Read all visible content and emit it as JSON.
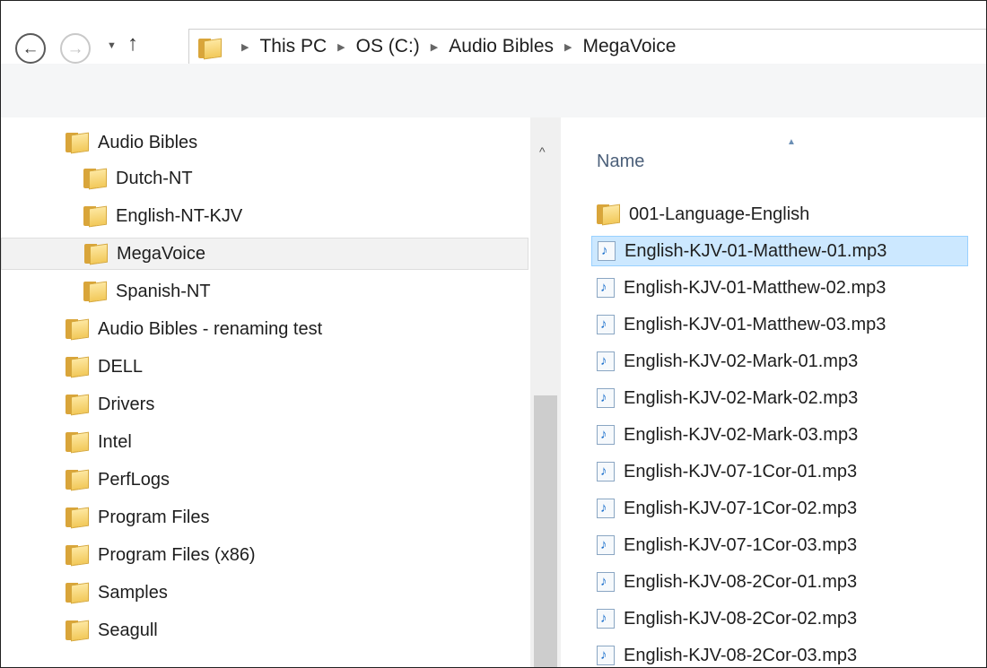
{
  "breadcrumb": [
    "This PC",
    "OS (C:)",
    "Audio Bibles",
    "MegaVoice"
  ],
  "colors": {
    "selection": "#cce8ff",
    "folder": "#f2c95a",
    "header_text": "#4c607a"
  },
  "nav_tree": [
    {
      "label": "Audio Bibles",
      "icon": "folder-icon",
      "selected": false
    },
    {
      "label": "Dutch-NT",
      "icon": "folder-icon",
      "selected": false
    },
    {
      "label": "English-NT-KJV",
      "icon": "folder-icon",
      "selected": false
    },
    {
      "label": "MegaVoice",
      "icon": "folder-icon",
      "selected": true
    },
    {
      "label": "Spanish-NT",
      "icon": "folder-icon",
      "selected": false
    },
    {
      "label": "Audio Bibles - renaming test",
      "icon": "folder-icon",
      "selected": false
    },
    {
      "label": "DELL",
      "icon": "folder-icon",
      "selected": false
    },
    {
      "label": "Drivers",
      "icon": "folder-icon",
      "selected": false
    },
    {
      "label": "Intel",
      "icon": "folder-icon",
      "selected": false
    },
    {
      "label": "PerfLogs",
      "icon": "folder-icon",
      "selected": false
    },
    {
      "label": "Program Files",
      "icon": "folder-icon",
      "selected": false
    },
    {
      "label": "Program Files (x86)",
      "icon": "folder-icon",
      "selected": false
    },
    {
      "label": "Samples",
      "icon": "folder-icon",
      "selected": false
    },
    {
      "label": "Seagull",
      "icon": "folder-icon",
      "selected": false
    }
  ],
  "file_list": {
    "column_name": "Name",
    "items": [
      {
        "label": "001-Language-English",
        "icon": "folder-icon",
        "selected": false
      },
      {
        "label": "English-KJV-01-Matthew-01.mp3",
        "icon": "audio-file-icon",
        "selected": true
      },
      {
        "label": "English-KJV-01-Matthew-02.mp3",
        "icon": "audio-file-icon",
        "selected": false
      },
      {
        "label": "English-KJV-01-Matthew-03.mp3",
        "icon": "audio-file-icon",
        "selected": false
      },
      {
        "label": "English-KJV-02-Mark-01.mp3",
        "icon": "audio-file-icon",
        "selected": false
      },
      {
        "label": "English-KJV-02-Mark-02.mp3",
        "icon": "audio-file-icon",
        "selected": false
      },
      {
        "label": "English-KJV-02-Mark-03.mp3",
        "icon": "audio-file-icon",
        "selected": false
      },
      {
        "label": "English-KJV-07-1Cor-01.mp3",
        "icon": "audio-file-icon",
        "selected": false
      },
      {
        "label": "English-KJV-07-1Cor-02.mp3",
        "icon": "audio-file-icon",
        "selected": false
      },
      {
        "label": "English-KJV-07-1Cor-03.mp3",
        "icon": "audio-file-icon",
        "selected": false
      },
      {
        "label": "English-KJV-08-2Cor-01.mp3",
        "icon": "audio-file-icon",
        "selected": false
      },
      {
        "label": "English-KJV-08-2Cor-02.mp3",
        "icon": "audio-file-icon",
        "selected": false
      },
      {
        "label": "English-KJV-08-2Cor-03.mp3",
        "icon": "audio-file-icon",
        "selected": false
      }
    ]
  }
}
